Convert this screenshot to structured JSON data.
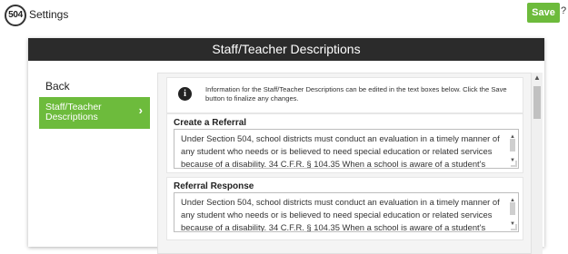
{
  "app": {
    "logo_text": "504",
    "title": "Settings",
    "save_label": "Save",
    "help_label": "?"
  },
  "modal": {
    "title": "Staff/Teacher Descriptions",
    "back_label": "Back",
    "nav_item_label": "Staff/Teacher Descriptions",
    "nav_chevron": "›",
    "info_icon": "i",
    "info_text": "Information for the Staff/Teacher Descriptions can be edited in the text boxes below. Click the Save button to finalize any changes.",
    "sections": [
      {
        "title": "Create a Referral",
        "text": "Under Section 504, school districts must conduct an evaluation in a timely manner of any student who needs or is believed to need special education or related services because of a disability. 34 C.F.R. § 104.35 When a school is aware of a student's"
      },
      {
        "title": "Referral Response",
        "text": "Under Section 504, school districts must conduct an evaluation in a timely manner of any student who needs or is believed to need special education or related services because of a disability. 34 C.F.R. § 104.35 When a school is aware of a student's"
      }
    ]
  },
  "colors": {
    "accent": "#6dbb3c",
    "header_bg": "#2b2b2b"
  },
  "icons": {
    "info": "info-icon",
    "chevron": "chevron-right-icon",
    "scroll_up": "▲",
    "scroll_down": "▼"
  }
}
